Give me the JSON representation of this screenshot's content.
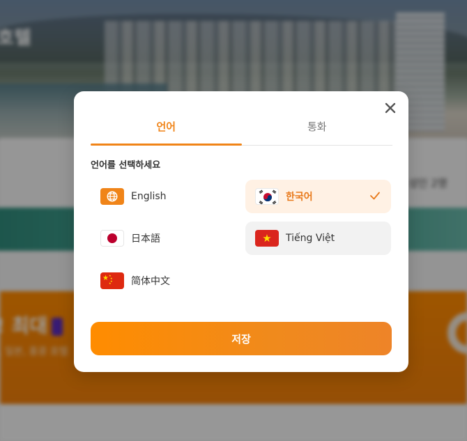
{
  "background": {
    "hero_title": "호텔",
    "guests_text": "성인 2명",
    "promo_title": "! 최대",
    "promo_subtitle": ", 일본, 홍콩 호텔"
  },
  "modal": {
    "tabs": [
      {
        "label": "언어",
        "active": true
      },
      {
        "label": "통화",
        "active": false
      }
    ],
    "section_label": "언어를 선택하세요",
    "languages": [
      {
        "label": "English",
        "flag": "globe-icon",
        "selected": false
      },
      {
        "label": "한국어",
        "flag": "flag-korea-icon",
        "selected": true
      },
      {
        "label": "日本語",
        "flag": "flag-japan-icon",
        "selected": false
      },
      {
        "label": "Tiếng Việt",
        "flag": "flag-vietnam-icon",
        "selected": false
      },
      {
        "label": "简体中文",
        "flag": "flag-china-icon",
        "selected": false
      }
    ],
    "save_label": "저장",
    "close_icon": "close-icon",
    "check_icon": "check-icon"
  },
  "colors": {
    "accent": "#f08418",
    "selected_bg": "#fff1e4",
    "hover_bg": "#f2f2f2"
  }
}
